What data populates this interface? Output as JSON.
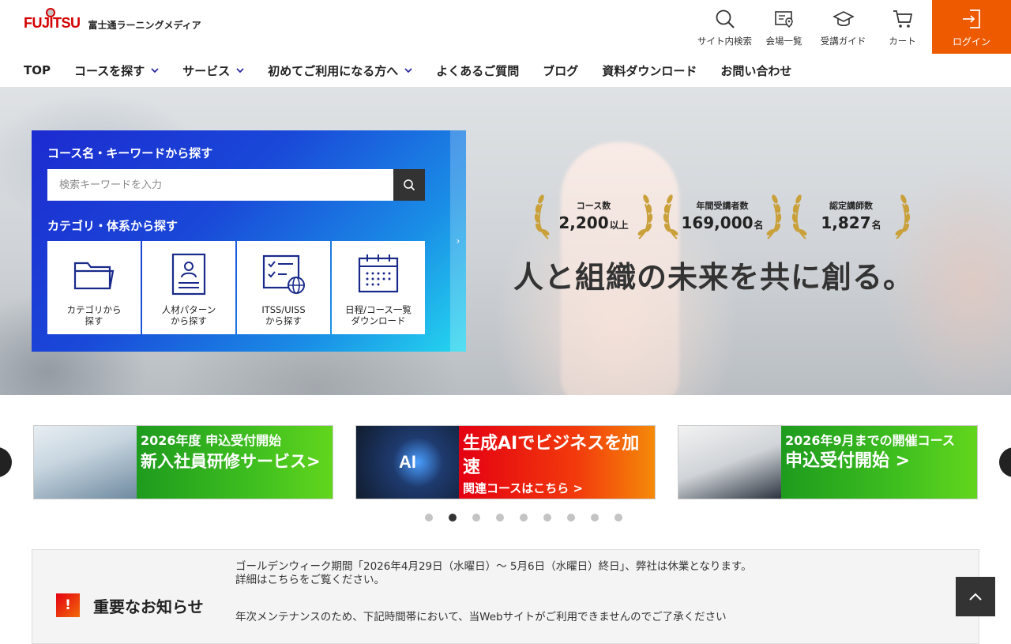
{
  "header": {
    "logo_text": "FUJITSU",
    "logo_sub": "富士通ラーニングメディア",
    "util": [
      {
        "label": "サイト内検索",
        "icon": "search-icon"
      },
      {
        "label": "会場一覧",
        "icon": "map-pin-icon"
      },
      {
        "label": "受講ガイド",
        "icon": "graduation-cap-icon"
      },
      {
        "label": "カート",
        "icon": "cart-icon"
      }
    ],
    "login_label": "ログイン",
    "login_color": "#ee5a00"
  },
  "nav": {
    "items": [
      {
        "label": "TOP",
        "has_dropdown": false
      },
      {
        "label": "コースを探す",
        "has_dropdown": true
      },
      {
        "label": "サービス",
        "has_dropdown": true
      },
      {
        "label": "初めてご利用になる方へ",
        "has_dropdown": true
      },
      {
        "label": "よくあるご質問",
        "has_dropdown": false
      },
      {
        "label": "ブログ",
        "has_dropdown": false
      },
      {
        "label": "資料ダウンロード",
        "has_dropdown": false
      },
      {
        "label": "お問い合わせ",
        "has_dropdown": false
      }
    ],
    "dropdown_color": "#2a2aa0"
  },
  "search_panel": {
    "keyword_heading": "コース名・キーワードから探す",
    "placeholder": "検索キーワードを入力",
    "category_heading": "カテゴリ・体系から探す",
    "toggle_glyph": "›",
    "categories": [
      {
        "label": "カテゴリから\n探す",
        "icon": "folder-icon"
      },
      {
        "label": "人材パターン\nから探す",
        "icon": "profile-card-icon"
      },
      {
        "label": "ITSS/UISS\nから探す",
        "icon": "checklist-globe-icon"
      },
      {
        "label": "日程/コース一覧\nダウンロード",
        "icon": "calendar-icon"
      }
    ]
  },
  "hero": {
    "stats": [
      {
        "label": "コース数",
        "value": "2,200",
        "unit": "以上"
      },
      {
        "label": "年間受講者数",
        "value": "169,000",
        "unit": "名"
      },
      {
        "label": "認定講師数",
        "value": "1,827",
        "unit": "名"
      }
    ],
    "tagline": "人と組織の未来を共に創る。"
  },
  "banners": [
    {
      "line1": "2026年度 申込受付開始",
      "line2": "新入社員研修サービス>"
    },
    {
      "line1": "生成AIでビジネスを加速",
      "line2": "関連コースはこちら >",
      "photo_text": "AI"
    },
    {
      "line1": "2026年9月までの開催コース",
      "line2": "申込受付開始 >"
    }
  ],
  "carousel": {
    "dot_count": 9,
    "active_index": 1
  },
  "notice": {
    "title": "重要なお知らせ",
    "icon_glyph": "!",
    "items": [
      {
        "line1": "ゴールデンウィーク期間「2026年4月29日（水曜日）～ 5月6日（水曜日）終日」、弊社は休業となります。",
        "line2": "詳細はこちらをご覧ください。"
      },
      {
        "line1": "年次メンテナンスのため、下記時間帯において、当Webサイトがご利用できませんのでご了承ください"
      }
    ]
  }
}
